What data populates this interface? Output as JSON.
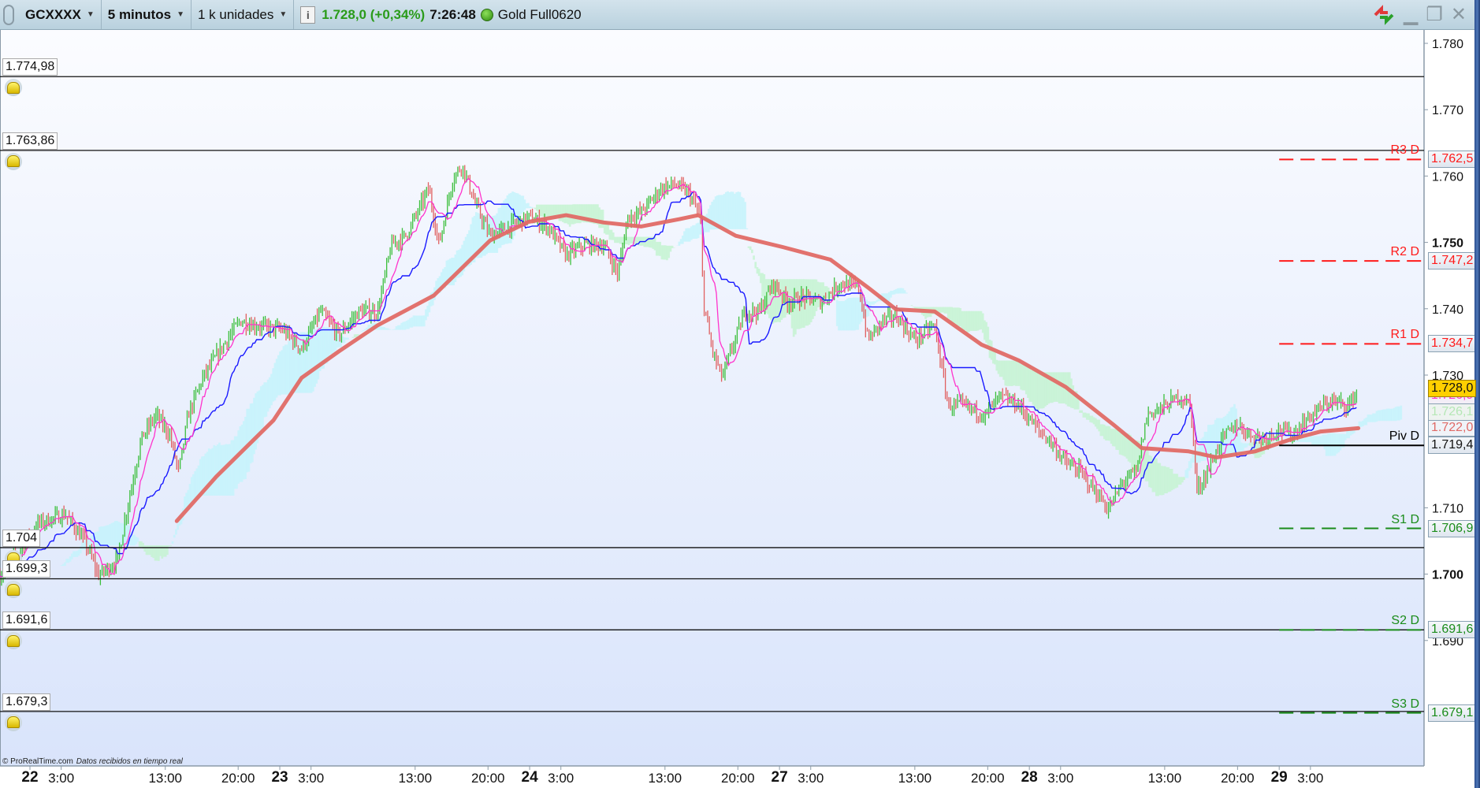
{
  "toolbar": {
    "instrument": "GCXXXX",
    "timeframe": "5 minutos",
    "units": "1 k unidades",
    "last_price": "1.728,0 (+0,34%)",
    "time": "7:26:48",
    "contract": "Gold Full0620"
  },
  "colors": {
    "up": "#3cbf3c",
    "down": "#e06060",
    "tenkan": "#ff33cc",
    "kijun": "#1a1aff",
    "ma": "#e06a66",
    "cloud_up": "#c6f3fb",
    "cloud_down": "#c6f3d2",
    "resistance": "#ff1a1a",
    "support": "#1a8c1a",
    "pivot": "#000000",
    "last_price_bg": "#ffd000"
  },
  "footer": {
    "copyright": "© ProRealTime.com",
    "status": "Datos recibidos en tiempo real"
  },
  "chart_data": {
    "type": "candlestick",
    "x_unit": "hours since day 22 00:00 (trading time)",
    "ylim": [
      1.67,
      1.785
    ],
    "y_ticks": [
      {
        "v": 1.78,
        "label": "1.780",
        "bold": false
      },
      {
        "v": 1.77,
        "label": "1.770",
        "bold": false
      },
      {
        "v": 1.76,
        "label": "1.760",
        "bold": false
      },
      {
        "v": 1.75,
        "label": "1.750",
        "bold": true
      },
      {
        "v": 1.74,
        "label": "1.740",
        "bold": false
      },
      {
        "v": 1.73,
        "label": "1.730",
        "bold": false
      },
      {
        "v": 1.71,
        "label": "1.710",
        "bold": false
      },
      {
        "v": 1.7,
        "label": "1.700",
        "bold": true
      },
      {
        "v": 1.69,
        "label": "1.690",
        "bold": false
      }
    ],
    "x_ticks": [
      {
        "h": 0,
        "label": "22",
        "bold": true
      },
      {
        "h": 3,
        "label": "3:00"
      },
      {
        "h": 13,
        "label": "13:00"
      },
      {
        "h": 20,
        "label": "20:00"
      },
      {
        "h": 24,
        "label": "23",
        "bold": true
      },
      {
        "h": 27,
        "label": "3:00"
      },
      {
        "h": 37,
        "label": "13:00"
      },
      {
        "h": 44,
        "label": "20:00"
      },
      {
        "h": 48,
        "label": "24",
        "bold": true
      },
      {
        "h": 51,
        "label": "3:00"
      },
      {
        "h": 61,
        "label": "13:00"
      },
      {
        "h": 68,
        "label": "20:00"
      },
      {
        "h": 72,
        "label": "27",
        "bold": true
      },
      {
        "h": 75,
        "label": "3:00"
      },
      {
        "h": 85,
        "label": "13:00"
      },
      {
        "h": 92,
        "label": "20:00"
      },
      {
        "h": 96,
        "label": "28",
        "bold": true
      },
      {
        "h": 99,
        "label": "3:00"
      },
      {
        "h": 109,
        "label": "13:00"
      },
      {
        "h": 116,
        "label": "20:00"
      },
      {
        "h": 120,
        "label": "29",
        "bold": true
      },
      {
        "h": 123,
        "label": "3:00"
      }
    ],
    "price_path": [
      [
        -2.9,
        1.6998
      ],
      [
        -1.1,
        1.7033
      ],
      [
        0.7,
        1.7076
      ],
      [
        3.4,
        1.709
      ],
      [
        5.3,
        1.7048
      ],
      [
        6.6,
        1.6998
      ],
      [
        8.4,
        1.702
      ],
      [
        9.3,
        1.7097
      ],
      [
        10.7,
        1.7204
      ],
      [
        12.1,
        1.724
      ],
      [
        13.4,
        1.7211
      ],
      [
        14.3,
        1.7154
      ],
      [
        15.2,
        1.724
      ],
      [
        16.6,
        1.7296
      ],
      [
        18.9,
        1.7353
      ],
      [
        20.2,
        1.7382
      ],
      [
        21.6,
        1.7375
      ],
      [
        24.3,
        1.7368
      ],
      [
        26.1,
        1.7339
      ],
      [
        27.9,
        1.7396
      ],
      [
        29.7,
        1.736
      ],
      [
        31.6,
        1.7396
      ],
      [
        33.4,
        1.7396
      ],
      [
        34.7,
        1.7496
      ],
      [
        36.1,
        1.751
      ],
      [
        37.0,
        1.7538
      ],
      [
        38.3,
        1.7581
      ],
      [
        39.3,
        1.7496
      ],
      [
        40.6,
        1.7595
      ],
      [
        41.5,
        1.7617
      ],
      [
        42.9,
        1.7553
      ],
      [
        44.2,
        1.751
      ],
      [
        46.1,
        1.7524
      ],
      [
        47.9,
        1.7538
      ],
      [
        49.7,
        1.7524
      ],
      [
        51.5,
        1.7481
      ],
      [
        53.3,
        1.7496
      ],
      [
        55.1,
        1.7496
      ],
      [
        56.5,
        1.7453
      ],
      [
        57.4,
        1.7538
      ],
      [
        58.7,
        1.7545
      ],
      [
        60.6,
        1.7581
      ],
      [
        61.9,
        1.7588
      ],
      [
        63.3,
        1.7574
      ],
      [
        64.4,
        1.7538
      ],
      [
        64.7,
        1.741
      ],
      [
        65.5,
        1.7339
      ],
      [
        66.5,
        1.7296
      ],
      [
        67.4,
        1.7339
      ],
      [
        68.7,
        1.7396
      ],
      [
        70.1,
        1.7396
      ],
      [
        71.4,
        1.7439
      ],
      [
        72.8,
        1.741
      ],
      [
        74.2,
        1.7417
      ],
      [
        76.0,
        1.741
      ],
      [
        77.8,
        1.7439
      ],
      [
        79.6,
        1.7432
      ],
      [
        80.5,
        1.7353
      ],
      [
        81.9,
        1.7382
      ],
      [
        83.2,
        1.7389
      ],
      [
        85.0,
        1.7353
      ],
      [
        86.9,
        1.7375
      ],
      [
        88.2,
        1.7254
      ],
      [
        89.6,
        1.7254
      ],
      [
        91.8,
        1.724
      ],
      [
        93.2,
        1.7268
      ],
      [
        95.0,
        1.7254
      ],
      [
        96.8,
        1.7218
      ],
      [
        98.2,
        1.7197
      ],
      [
        99.5,
        1.7168
      ],
      [
        100.9,
        1.7154
      ],
      [
        102.3,
        1.7126
      ],
      [
        103.6,
        1.7097
      ],
      [
        105.0,
        1.714
      ],
      [
        106.3,
        1.7154
      ],
      [
        107.3,
        1.724
      ],
      [
        109.1,
        1.7254
      ],
      [
        110.4,
        1.7268
      ],
      [
        111.5,
        1.7254
      ],
      [
        112.1,
        1.7126
      ],
      [
        113.1,
        1.7154
      ],
      [
        114.5,
        1.7204
      ],
      [
        115.9,
        1.7225
      ],
      [
        117.2,
        1.7211
      ],
      [
        118.6,
        1.7204
      ],
      [
        119.9,
        1.7218
      ],
      [
        121.3,
        1.7211
      ],
      [
        123.1,
        1.724
      ],
      [
        124.9,
        1.7261
      ],
      [
        126.7,
        1.7254
      ],
      [
        127.6,
        1.728
      ]
    ],
    "moving_average": [
      [
        14.1,
        1.708
      ],
      [
        17.9,
        1.7147
      ],
      [
        23.4,
        1.7232
      ],
      [
        26.1,
        1.7296
      ],
      [
        29.7,
        1.7336
      ],
      [
        33.4,
        1.7375
      ],
      [
        38.8,
        1.742
      ],
      [
        44.2,
        1.7503
      ],
      [
        47.9,
        1.7531
      ],
      [
        51.5,
        1.7541
      ],
      [
        55.1,
        1.753
      ],
      [
        58.7,
        1.7524
      ],
      [
        62.4,
        1.7535
      ],
      [
        64.2,
        1.7541
      ],
      [
        67.8,
        1.751
      ],
      [
        72.3,
        1.7493
      ],
      [
        76.9,
        1.7474
      ],
      [
        80.5,
        1.7432
      ],
      [
        83.2,
        1.7399
      ],
      [
        86.9,
        1.7396
      ],
      [
        91.4,
        1.7346
      ],
      [
        95.0,
        1.7322
      ],
      [
        99.5,
        1.7282
      ],
      [
        104.1,
        1.7225
      ],
      [
        106.8,
        1.719
      ],
      [
        111.3,
        1.7185
      ],
      [
        114.0,
        1.7176
      ],
      [
        117.7,
        1.7185
      ],
      [
        121.3,
        1.7204
      ],
      [
        124.0,
        1.7215
      ],
      [
        127.6,
        1.722
      ]
    ],
    "alert_lines": [
      {
        "v": 1.77498,
        "label": "1.774,98"
      },
      {
        "v": 1.76386,
        "label": "1.763,86"
      },
      {
        "v": 1.704,
        "label": "1.704"
      },
      {
        "v": 1.6993,
        "label": "1.699,3"
      },
      {
        "v": 1.6916,
        "label": "1.691,6"
      },
      {
        "v": 1.6793,
        "label": "1.679,3"
      }
    ],
    "pivots_start_h": 120,
    "pivots": [
      {
        "name": "R3 D",
        "v": 1.7625,
        "label": "1.762,5",
        "kind": "resistance"
      },
      {
        "name": "R2 D",
        "v": 1.7472,
        "label": "1.747,2",
        "kind": "resistance"
      },
      {
        "name": "R1 D",
        "v": 1.7347,
        "label": "1.734,7",
        "kind": "resistance"
      },
      {
        "name": "Piv D",
        "v": 1.7194,
        "label": "1.719,4",
        "kind": "pivot"
      },
      {
        "name": "S1 D",
        "v": 1.7069,
        "label": "1.706,9",
        "kind": "support"
      },
      {
        "name": "S2 D",
        "v": 1.6916,
        "label": "1.691,6",
        "kind": "support"
      },
      {
        "name": "S3 D",
        "v": 1.6791,
        "label": "1.679,1",
        "kind": "support"
      }
    ],
    "indicator_values": [
      {
        "v": 1.728,
        "label": "1.728,0",
        "role": "last"
      },
      {
        "v": 1.7269,
        "label": "1.726,9",
        "role": "tenkan"
      },
      {
        "v": 1.7261,
        "label": "1.726,1",
        "role": "cloud"
      },
      {
        "v": 1.722,
        "label": "1.722,0",
        "role": "ma"
      }
    ]
  }
}
